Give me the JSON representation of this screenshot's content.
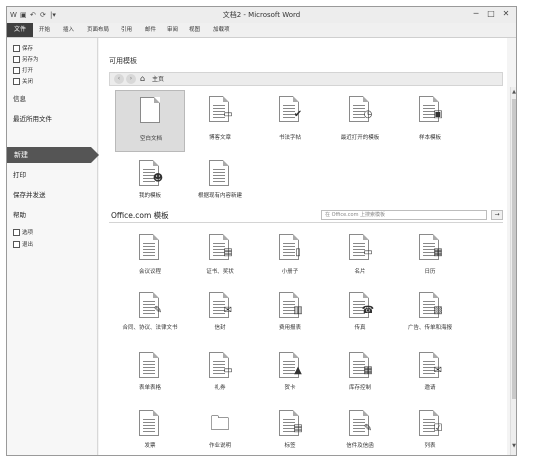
{
  "window": {
    "title": "文档2 - Microsoft Word",
    "quick_access": [
      "W",
      "▣",
      "↶",
      "⟳",
      "|▾"
    ],
    "controls": [
      "─",
      "□",
      "✕"
    ]
  },
  "ribbon": {
    "file_tab": "文件",
    "tabs": [
      "开始",
      "插入",
      "页面布局",
      "引用",
      "邮件",
      "审阅",
      "视图",
      "加载项"
    ]
  },
  "sidebar": {
    "small_items": [
      {
        "label": "保存",
        "icon": "save-icon"
      },
      {
        "label": "另存为",
        "icon": "save-as-icon"
      },
      {
        "label": "打开",
        "icon": "open-folder-icon"
      },
      {
        "label": "关闭",
        "icon": "close-doc-icon"
      }
    ],
    "big_items": [
      "信息",
      "最近所用文件"
    ],
    "active_item": "新建",
    "lower_items": [
      "打印",
      "保存并发送",
      "帮助"
    ],
    "bottom_items": [
      {
        "label": "选项",
        "icon": "options-icon"
      },
      {
        "label": "退出",
        "icon": "exit-icon"
      }
    ]
  },
  "available_templates": {
    "title": "可用模板",
    "nav": {
      "back": "‹",
      "forward": "›",
      "home_icon": "home-icon",
      "home_label": "主页"
    },
    "items": [
      {
        "label": "空白文档",
        "icon": "blank-doc-icon",
        "selected": true
      },
      {
        "label": "博客文章",
        "icon": "blog-post-icon"
      },
      {
        "label": "书法字帖",
        "icon": "calligraphy-icon"
      },
      {
        "label": "最近打开的模板",
        "icon": "recent-templates-icon"
      },
      {
        "label": "样本模板",
        "icon": "sample-templates-icon"
      },
      {
        "label": "我的模板",
        "icon": "my-templates-icon"
      },
      {
        "label": "根据现有内容新建",
        "icon": "new-from-existing-icon"
      }
    ]
  },
  "office_com": {
    "title": "Office.com 模板",
    "search_placeholder": "在 Office.com 上搜索模板",
    "search_go": "→",
    "items": [
      {
        "label": "会议议程",
        "icon": "agenda-icon"
      },
      {
        "label": "证书、奖状",
        "icon": "certificate-icon"
      },
      {
        "label": "小册子",
        "icon": "brochure-icon"
      },
      {
        "label": "名片",
        "icon": "business-card-icon"
      },
      {
        "label": "日历",
        "icon": "calendar-icon"
      },
      {
        "label": "合同、协议、法律文书",
        "icon": "contract-icon"
      },
      {
        "label": "信封",
        "icon": "envelope-icon"
      },
      {
        "label": "费用报表",
        "icon": "expense-report-icon"
      },
      {
        "label": "传真",
        "icon": "fax-icon"
      },
      {
        "label": "广告、传单和海报",
        "icon": "flyer-icon"
      },
      {
        "label": "表单表格",
        "icon": "form-icon"
      },
      {
        "label": "礼券",
        "icon": "gift-certificate-icon"
      },
      {
        "label": "贺卡",
        "icon": "greeting-card-icon"
      },
      {
        "label": "库存控制",
        "icon": "inventory-icon"
      },
      {
        "label": "邀请",
        "icon": "invitation-icon"
      },
      {
        "label": "发票",
        "icon": "invoice-icon"
      },
      {
        "label": "作业说明",
        "icon": "job-folder-icon"
      },
      {
        "label": "标签",
        "icon": "labels-icon"
      },
      {
        "label": "信件及信函",
        "icon": "letters-icon"
      },
      {
        "label": "列表",
        "icon": "list-icon"
      }
    ]
  }
}
